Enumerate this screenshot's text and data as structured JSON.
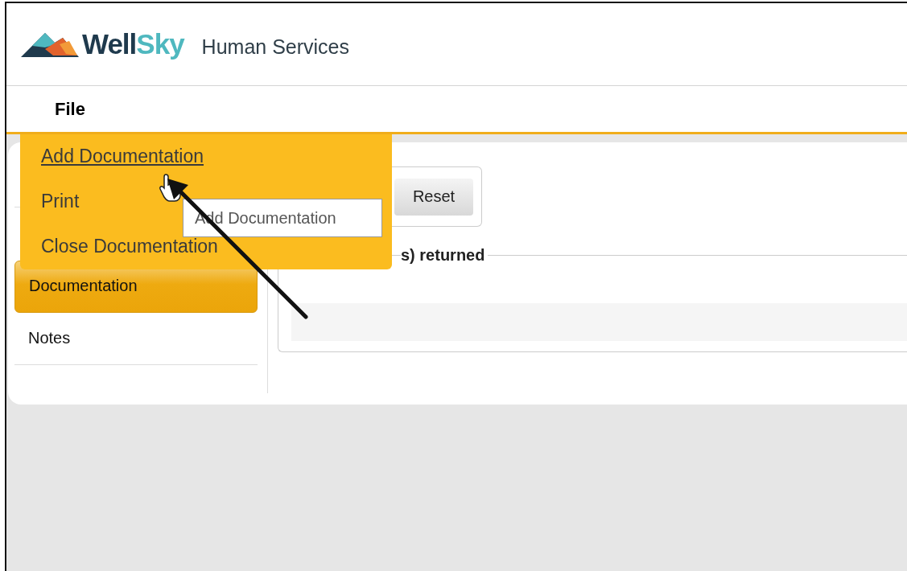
{
  "header": {
    "brand": {
      "first": "Well",
      "second": "Sky"
    },
    "product": "Human Services"
  },
  "menu_bar": [
    {
      "label": "File",
      "expanded": true
    }
  ],
  "file_menu": [
    {
      "label": "Add Documentation",
      "hovered": true
    },
    {
      "label": "Print",
      "hovered": false
    },
    {
      "label": "Close Documentation",
      "hovered": false
    }
  ],
  "tooltip": "Add Documentation",
  "sidebar": {
    "items": [
      {
        "label": "Documentation",
        "selected": true
      },
      {
        "label": "Notes",
        "selected": false
      }
    ]
  },
  "search": {
    "buttons": [
      "Reset"
    ]
  },
  "results": {
    "legend": "s) returned"
  }
}
